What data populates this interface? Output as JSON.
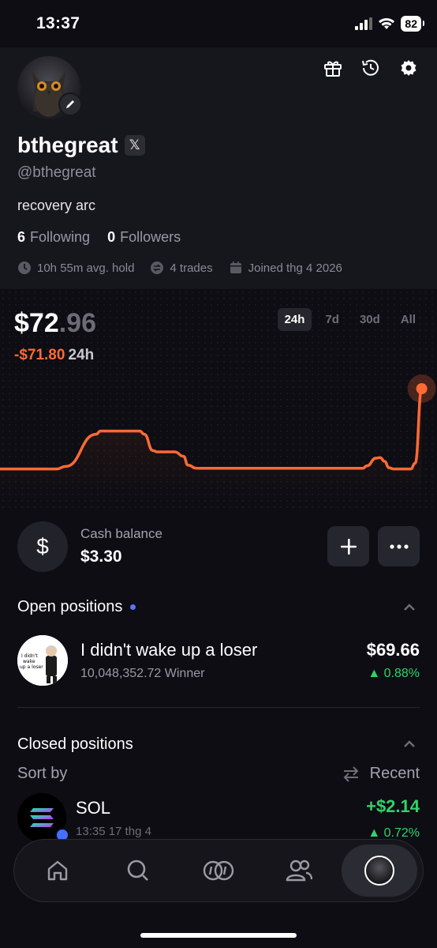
{
  "status": {
    "time": "13:37",
    "battery": "82"
  },
  "profile": {
    "username": "bthegreat",
    "x_badge": "𝕏",
    "handle": "@bthegreat",
    "bio": "recovery arc",
    "following_count": "6",
    "following_label": "Following",
    "followers_count": "0",
    "followers_label": "Followers",
    "avg_hold": "10h 55m avg. hold",
    "trades": "4 trades",
    "joined": "Joined thg 4 2026"
  },
  "portfolio": {
    "balance_main": "$72",
    "balance_decimal": ".96",
    "change_value": "-$71.80",
    "change_period": "24h",
    "ranges": [
      "24h",
      "7d",
      "30d",
      "All"
    ],
    "active_range": "24h",
    "line_color": "#ff6a36"
  },
  "chart_data": {
    "type": "line",
    "x_range": [
      0,
      100
    ],
    "values": [
      [
        0,
        23
      ],
      [
        13,
        23
      ],
      [
        15,
        27
      ],
      [
        22,
        78
      ],
      [
        23,
        83
      ],
      [
        32,
        83
      ],
      [
        33,
        78
      ],
      [
        35,
        52
      ],
      [
        36,
        50
      ],
      [
        40,
        50
      ],
      [
        42,
        43
      ],
      [
        43,
        29
      ],
      [
        45,
        24
      ],
      [
        60,
        24
      ],
      [
        75,
        24
      ],
      [
        83,
        24
      ],
      [
        84,
        28
      ],
      [
        86,
        40
      ],
      [
        87,
        41
      ],
      [
        88,
        35
      ],
      [
        89,
        25
      ],
      [
        90,
        23
      ],
      [
        94,
        23
      ],
      [
        95,
        32
      ],
      [
        96.5,
        150
      ]
    ],
    "ylim": [
      0,
      160
    ],
    "grid": false
  },
  "cash": {
    "label": "Cash balance",
    "value": "$3.30"
  },
  "open_positions": {
    "title": "Open positions",
    "items": [
      {
        "name": "I didn't wake up a loser",
        "sub": "10,048,352.72 Winner",
        "value": "$69.66",
        "pct": "▲ 0.88%",
        "thumb_text": "I didn't wake up a loser"
      }
    ]
  },
  "closed_positions": {
    "title": "Closed positions",
    "sort_label": "Sort by",
    "sort_value": "Recent",
    "items": [
      {
        "name": "SOL",
        "sub": "13:35 17 thg 4",
        "value": "+$2.14",
        "pct": "▲ 0.72%"
      }
    ]
  },
  "nav": [
    "home-icon",
    "search-icon",
    "coins-icon",
    "users-icon",
    "profile-avatar"
  ]
}
